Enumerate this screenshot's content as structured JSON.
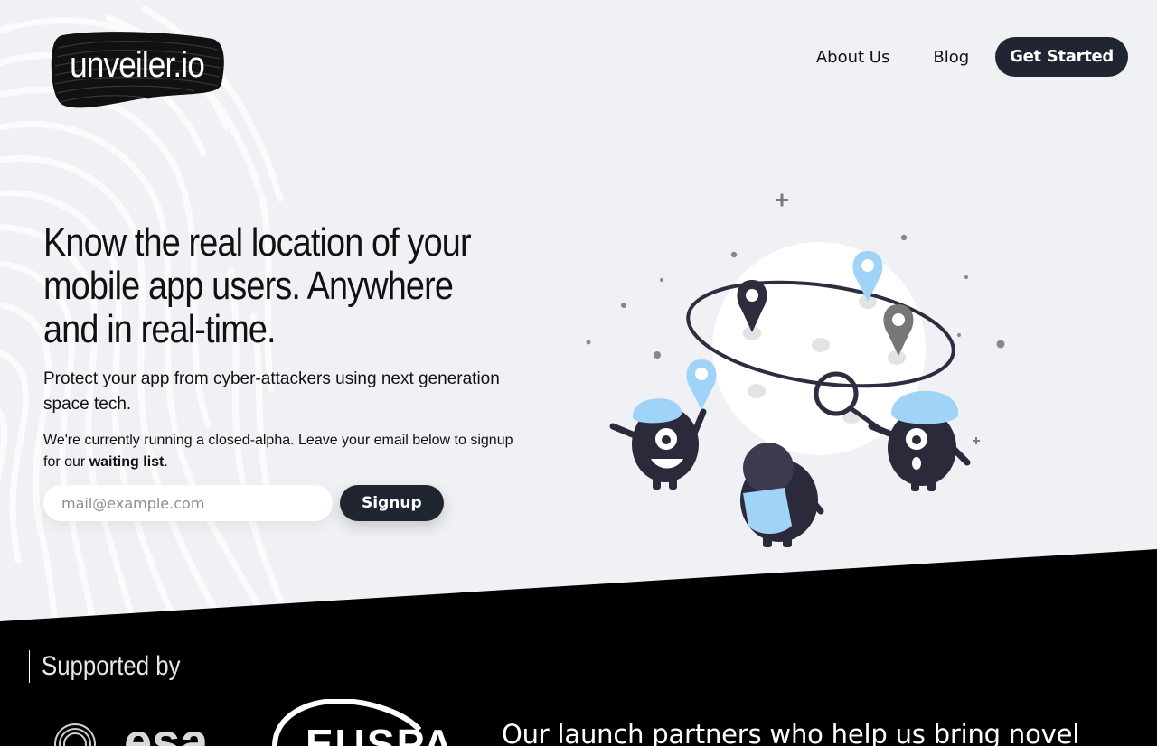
{
  "brand": {
    "logo_text": "unveiler.io"
  },
  "nav": {
    "about": "About Us",
    "blog": "Blog",
    "cta": "Get Started"
  },
  "hero": {
    "headline_line1": "Know the real location of your",
    "headline_line2": "mobile app users. Anywhere",
    "headline_line3": "and in real-time.",
    "subtitle": "Protect your app from cyber-attackers using next generation space tech.",
    "note_prefix": "We're currently running a closed-alpha. Leave your email below to signup for our ",
    "note_bold": "waiting list",
    "note_suffix": "."
  },
  "signup": {
    "placeholder": "mail@example.com",
    "button": "Signup"
  },
  "supported": {
    "heading": "Supported by",
    "partners_text": "Our launch partners who help us bring novel",
    "partner_logos": [
      "esa-logo",
      "euspa-logo"
    ],
    "partner_logo_text_1": "esa",
    "partner_logo_text_2": "EUSPA"
  },
  "colors": {
    "page_bg": "#f0f1f4",
    "dark": "#1f2531",
    "band": "#000000",
    "accent_blue": "#9fd3f7",
    "pin_dark": "#2e2c3f",
    "pin_gray": "#777777"
  }
}
